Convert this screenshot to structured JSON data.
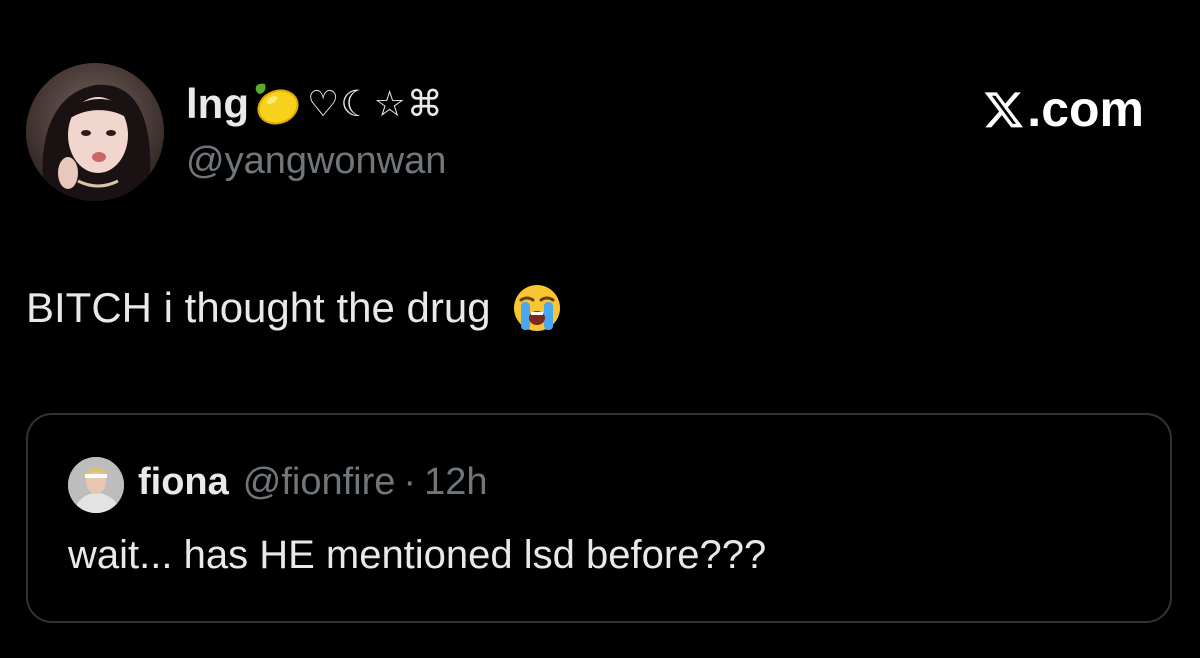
{
  "tweet": {
    "display_name_prefix": "lng",
    "display_name_emoji": "lemon-emoji",
    "display_name_symbols": "♡☾☆⌘",
    "handle": "@yangwonwan",
    "text": "BITCH i thought the drug",
    "text_emoji": "loudly-crying-face-emoji"
  },
  "watermark": {
    "label": ".com",
    "icon": "x-logo-icon"
  },
  "quoted_tweet": {
    "display_name": "fiona",
    "handle": "@fionfire",
    "separator": "·",
    "time": "12h",
    "text": "wait... has HE mentioned lsd before???"
  },
  "colors": {
    "background": "#000000",
    "primary_text": "#e7e9ea",
    "secondary_text": "#71767b",
    "border": "#2f3336"
  }
}
